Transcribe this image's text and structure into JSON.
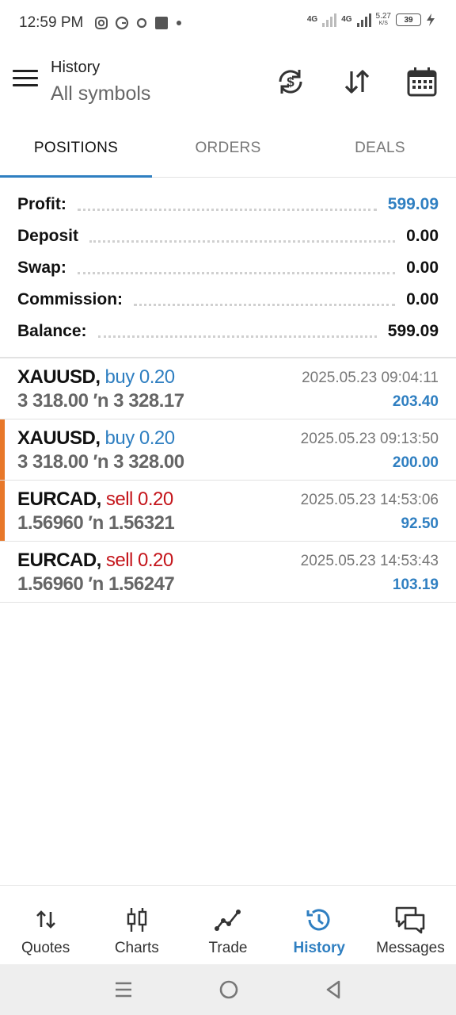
{
  "status_bar": {
    "time": "12:59 PM",
    "network1": "4G",
    "network2": "4G",
    "speed_value": "5.27",
    "speed_unit": "K/S",
    "battery": "39"
  },
  "toolbar": {
    "title": "History",
    "subtitle": "All symbols"
  },
  "tabs": [
    {
      "label": "POSITIONS",
      "active": true
    },
    {
      "label": "ORDERS",
      "active": false
    },
    {
      "label": "DEALS",
      "active": false
    }
  ],
  "summary": [
    {
      "label": "Profit:",
      "value": "599.09"
    },
    {
      "label": "Deposit",
      "value": "0.00"
    },
    {
      "label": "Swap:",
      "value": "0.00"
    },
    {
      "label": "Commission:",
      "value": "0.00"
    },
    {
      "label": "Balance:",
      "value": "599.09"
    }
  ],
  "positions": [
    {
      "symbol": "XAUUSD,",
      "side": "buy 0.20",
      "prices": "3 318.00 ′n  3 328.17",
      "time": "2025.05.23 09:04:11",
      "profit": "203.40"
    },
    {
      "symbol": "XAUUSD,",
      "side": "buy 0.20",
      "prices": "3 318.00 ′n  3 328.00",
      "time": "2025.05.23 09:13:50",
      "profit": "200.00"
    },
    {
      "symbol": "EURCAD,",
      "side": "sell 0.20",
      "prices": "1.56960 ′n  1.56321",
      "time": "2025.05.23 14:53:06",
      "profit": "92.50"
    },
    {
      "symbol": "EURCAD,",
      "side": "sell 0.20",
      "prices": "1.56960 ′n  1.56247",
      "time": "2025.05.23 14:53:43",
      "profit": "103.19"
    }
  ],
  "bottom_nav": [
    {
      "label": "Quotes",
      "icon": "quotes-icon"
    },
    {
      "label": "Charts",
      "icon": "charts-icon"
    },
    {
      "label": "Trade",
      "icon": "trade-icon"
    },
    {
      "label": "History",
      "icon": "history-icon",
      "active": true
    },
    {
      "label": "Messages",
      "icon": "messages-icon"
    }
  ],
  "colors": {
    "accent": "#2f7fc1",
    "sell": "#c4141a",
    "marker": "#e8782a"
  }
}
